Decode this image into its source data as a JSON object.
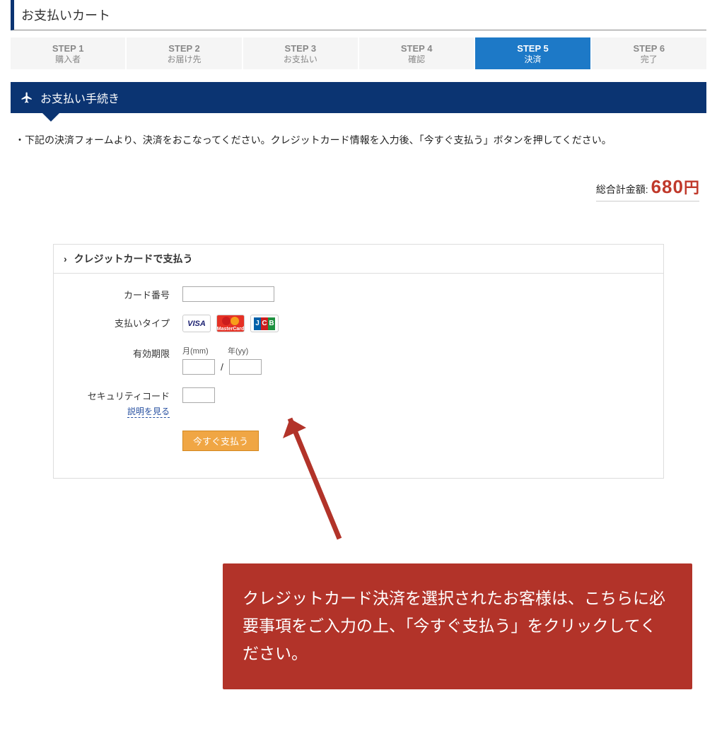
{
  "page_title": "お支払いカート",
  "steps": [
    {
      "num": "STEP 1",
      "label": "購入者"
    },
    {
      "num": "STEP 2",
      "label": "お届け先"
    },
    {
      "num": "STEP 3",
      "label": "お支払い"
    },
    {
      "num": "STEP 4",
      "label": "確認"
    },
    {
      "num": "STEP 5",
      "label": "決済"
    },
    {
      "num": "STEP 6",
      "label": "完了"
    }
  ],
  "active_step_index": 4,
  "section_title": "お支払い手続き",
  "instruction": "下記の決済フォームより、決済をおこなってください。クレジットカード情報を入力後、「今すぐ支払う」ボタンを押してください。",
  "total_label": "総合計金額:",
  "total_value": "680",
  "total_currency": "円",
  "panel_title": "クレジットカードで支払う",
  "form": {
    "card_number_label": "カード番号",
    "pay_type_label": "支払いタイプ",
    "expiry_label": "有効期限",
    "month_hint": "月(mm)",
    "year_hint": "年(yy)",
    "security_label": "セキュリティコード",
    "help_link": "説明を見る",
    "pay_button": "今すぐ支払う"
  },
  "card_brands": [
    "VISA",
    "MasterCard",
    "JCB"
  ],
  "callout_text": "クレジットカード決済を選択されたお客様は、こちらに必要事項をご入力の上、「今すぐ支払う」をクリックしてください。"
}
